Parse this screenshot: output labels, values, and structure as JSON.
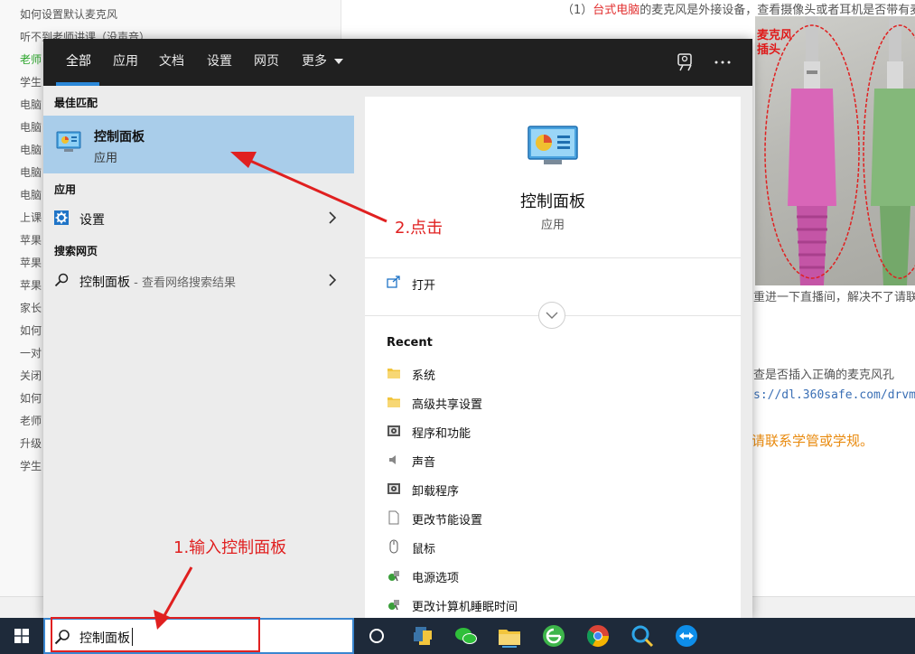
{
  "background": {
    "sidebar_links": [
      {
        "text": "如何设置默认麦克风",
        "green": false
      },
      {
        "text": "听不到老师讲课（没声音）",
        "green": false
      },
      {
        "text": "老师",
        "green": true
      },
      {
        "text": "学生",
        "green": false
      },
      {
        "text": "电脑",
        "green": false
      },
      {
        "text": "电脑",
        "green": false
      },
      {
        "text": "电脑",
        "green": false
      },
      {
        "text": "电脑",
        "green": false
      },
      {
        "text": "电脑",
        "green": false
      },
      {
        "text": "上课",
        "green": false
      },
      {
        "text": "苹果",
        "green": false
      },
      {
        "text": "苹果",
        "green": false
      },
      {
        "text": "苹果",
        "green": false
      },
      {
        "text": "家长",
        "green": false
      },
      {
        "text": "如何",
        "green": false
      },
      {
        "text": "一对",
        "green": false
      },
      {
        "text": "关闭",
        "green": false
      },
      {
        "text": "如何",
        "green": false
      },
      {
        "text": "老师",
        "green": false
      },
      {
        "text": "升级",
        "green": false
      },
      {
        "text": "学生",
        "green": false
      }
    ],
    "article_line1_prefix": "（1）",
    "article_line1_red": "台式电脑",
    "article_line1_rest": "的麦克风是外接设备，查看摄像头或者耳机是否带有麦",
    "photo_label": "麦克风插头",
    "line_retry": "重进一下直播间，解决不了请联",
    "line_check": "查是否插入正确的麦克风孔",
    "line_url": "s://dl.360safe.com/drvmgr",
    "line_orange": "请联系学管或学规。"
  },
  "menu": {
    "tabs": [
      "全部",
      "应用",
      "文档",
      "设置",
      "网页",
      "更多"
    ],
    "sections": {
      "best_match": "最佳匹配",
      "apps": "应用",
      "web": "搜索网页"
    },
    "best_match_item": {
      "title": "控制面板",
      "subtitle": "应用"
    },
    "app_item": {
      "label": "设置"
    },
    "web_item": {
      "label": "控制面板",
      "suffix": " - 查看网络搜索结果"
    },
    "preview": {
      "title": "控制面板",
      "subtitle": "应用",
      "open_label": "打开",
      "recent_heading": "Recent",
      "recent_items": [
        {
          "label": "系统",
          "icon": "folder-icon"
        },
        {
          "label": "高级共享设置",
          "icon": "folder-icon"
        },
        {
          "label": "程序和功能",
          "icon": "programs-icon"
        },
        {
          "label": "声音",
          "icon": "speaker-icon"
        },
        {
          "label": "卸载程序",
          "icon": "programs-icon"
        },
        {
          "label": "更改节能设置",
          "icon": "document-icon"
        },
        {
          "label": "鼠标",
          "icon": "mouse-icon"
        },
        {
          "label": "电源选项",
          "icon": "power-icon"
        },
        {
          "label": "更改计算机睡眠时间",
          "icon": "power-icon"
        }
      ]
    }
  },
  "taskbar": {
    "search_value": "控制面板"
  },
  "annotations": {
    "step1": "1.输入控制面板",
    "step2": "2.点击"
  },
  "colors": {
    "accent": "#2b88d8",
    "selection": "#a9cdea",
    "annotation": "#e02020"
  }
}
